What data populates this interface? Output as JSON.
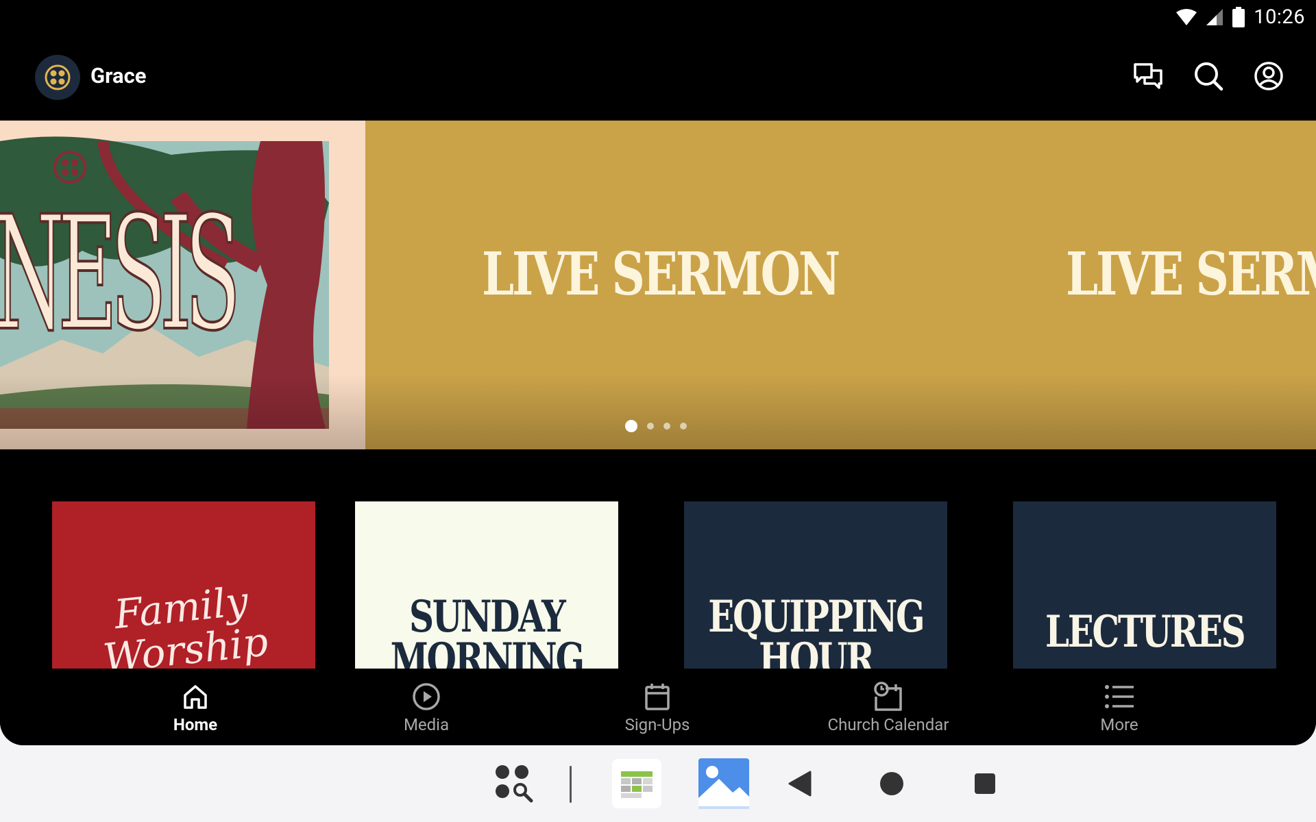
{
  "status_bar": {
    "time": "10:26"
  },
  "app_bar": {
    "title": "Grace",
    "actions": [
      {
        "icon": "chat-icon"
      },
      {
        "icon": "search-icon"
      },
      {
        "icon": "account-icon"
      }
    ]
  },
  "hero": {
    "slides": [
      {
        "title": "GENESIS",
        "visible_text": "NESIS"
      },
      {
        "title": "LIVE SERMON"
      },
      {
        "title": "LIVE SERMON"
      }
    ],
    "page_count": 4,
    "active_page": 1
  },
  "cards": [
    {
      "title": "FAMILY WORSHIP",
      "line1": "Family",
      "line2": "Worship"
    },
    {
      "title": "SUNDAY MORNING",
      "line1": "SUNDAY",
      "line2": "MORNING"
    },
    {
      "title": "EQUIPPING HOUR",
      "line1": "EQUIPPING",
      "line2": "HOUR"
    },
    {
      "title": "LECTURES",
      "line1": "LECTURES"
    }
  ],
  "bottom_nav": {
    "items": [
      {
        "label": "Home",
        "icon": "home-icon",
        "active": true
      },
      {
        "label": "Media",
        "icon": "play-circle-icon",
        "active": false
      },
      {
        "label": "Sign-Ups",
        "icon": "calendar-icon",
        "active": false
      },
      {
        "label": "Church Calendar",
        "icon": "calendar-clock-icon",
        "active": false
      },
      {
        "label": "More",
        "icon": "list-icon",
        "active": false
      }
    ]
  },
  "system_bar": {
    "buttons": [
      "app-drawer-search",
      "calendar-app",
      "gallery-app",
      "back",
      "home",
      "recents"
    ]
  },
  "colors": {
    "gold": "#caa248",
    "peach": "#fadcc4",
    "red": "#b02027",
    "cream": "#f8faec",
    "navy": "#1c2a3d"
  }
}
